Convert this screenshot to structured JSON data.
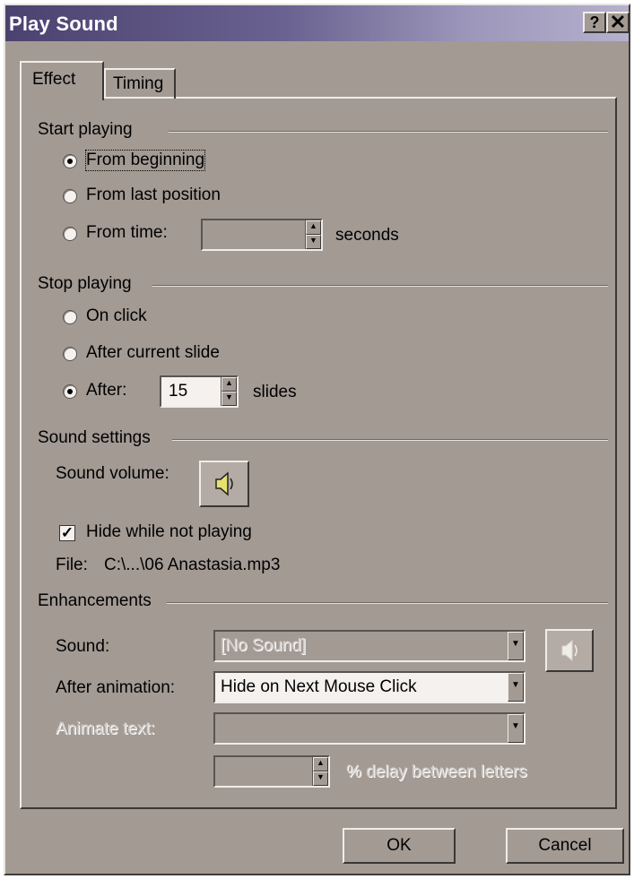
{
  "window": {
    "title": "Play Sound",
    "help_label": "?",
    "close_label": "✕"
  },
  "tabs": [
    {
      "label": "Effect",
      "selected": true
    },
    {
      "label": "Timing",
      "selected": false
    }
  ],
  "start_playing": {
    "group_label": "Start playing",
    "options": [
      {
        "label": "From beginning",
        "selected": true
      },
      {
        "label": "From last position",
        "selected": false
      },
      {
        "label": "From time:",
        "selected": false
      }
    ],
    "time_value": "",
    "time_unit": "seconds"
  },
  "stop_playing": {
    "group_label": "Stop playing",
    "options": [
      {
        "label": "On click",
        "selected": false
      },
      {
        "label": "After current slide",
        "selected": false
      },
      {
        "label": "After:",
        "selected": true
      }
    ],
    "slides_value": "15",
    "slides_unit": "slides"
  },
  "sound_settings": {
    "group_label": "Sound settings",
    "volume_label": "Sound volume:",
    "hide_label": "Hide while not playing",
    "hide_checked": true,
    "file_label": "File:",
    "file_value": "C:\\...\\06 Anastasia.mp3"
  },
  "enhancements": {
    "group_label": "Enhancements",
    "sound_label": "Sound:",
    "sound_value": "[No Sound]",
    "after_animation_label": "After animation:",
    "after_animation_value": "Hide on Next Mouse Click",
    "animate_text_label": "Animate text:",
    "animate_text_value": "",
    "delay_value": "",
    "delay_label": "% delay between letters"
  },
  "footer": {
    "ok_label": "OK",
    "cancel_label": "Cancel"
  },
  "icons": {
    "speaker": "speaker-icon",
    "spin": "spin-arrows-icon",
    "dropdown": "chevron-down-icon"
  },
  "colors": {
    "dialog_bg": "#a39a94",
    "title_start": "#4b4270",
    "title_end": "#b5b0cd",
    "speaker_cone": "#e6e070"
  }
}
